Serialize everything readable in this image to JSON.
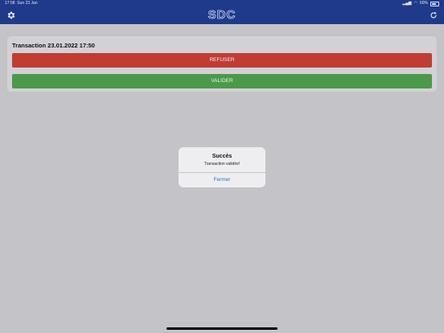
{
  "status_bar": {
    "time": "17:58",
    "date": "Sun 23 Jan",
    "battery": "60%"
  },
  "header": {
    "logo": "SDC",
    "left_icon": "gear-icon",
    "right_icon": "refresh-icon",
    "background": "#1f3a8a"
  },
  "transaction": {
    "title": "Transaction 23.01.2022 17:50",
    "refuse_label": "REFUSER",
    "validate_label": "VALIDER",
    "refuse_color": "#c13c33",
    "validate_color": "#4a9a49"
  },
  "alert": {
    "title": "Succès",
    "message": "Transaction validée!",
    "button_label": "Fermer",
    "button_color": "#2f73d9"
  }
}
